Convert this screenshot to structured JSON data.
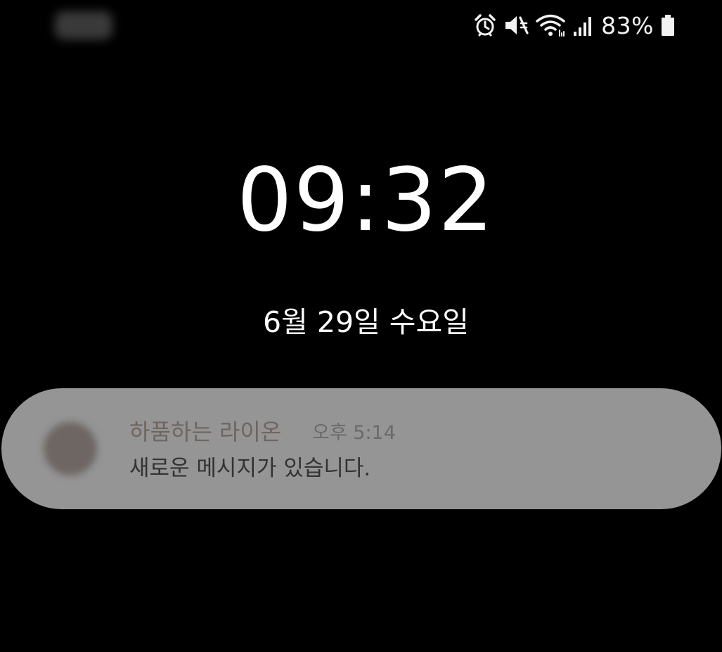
{
  "status_bar": {
    "battery_percent": "83%",
    "icons": [
      "alarm-icon",
      "mute-icon",
      "wifi-icon",
      "signal-icon",
      "battery-icon"
    ]
  },
  "lockscreen": {
    "time": "09:32",
    "date": "6월 29일 수요일"
  },
  "notification": {
    "sender": "하품하는 라이온",
    "time": "오후 5:14",
    "message": "새로운 메시지가 있습니다."
  },
  "colors": {
    "background": "#000000",
    "notification_bg": "#959595",
    "sender_text": "#6f6560",
    "message_text": "#333333"
  }
}
